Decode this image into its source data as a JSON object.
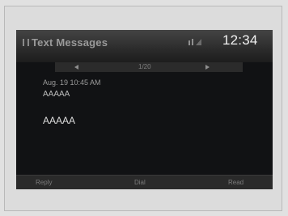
{
  "header": {
    "title": "Text Messages",
    "clock": "12:34",
    "signal_icon": "signal-icon",
    "menu_icon": "menu-icon"
  },
  "pager": {
    "count": "1/20",
    "prev_icon": "left-arrow-icon",
    "next_icon": "right-arrow-icon"
  },
  "message": {
    "date": "Aug. 19 10:45 AM",
    "from": "AAAAA",
    "body": "AAAAA"
  },
  "actions": {
    "reply": "Reply",
    "dial": "Dial",
    "read": "Read"
  }
}
